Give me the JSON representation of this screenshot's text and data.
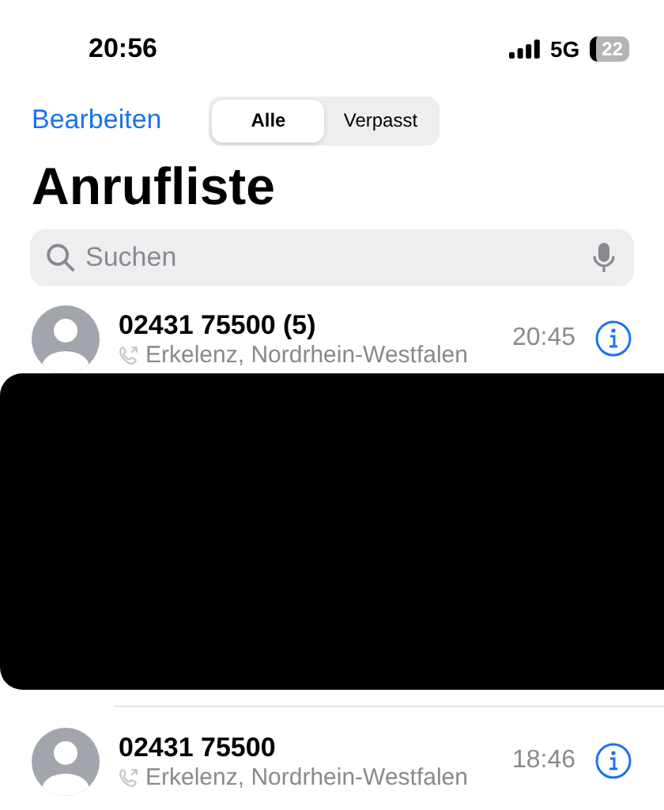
{
  "status_bar": {
    "time": "20:56",
    "network": "5G",
    "battery": "22"
  },
  "nav": {
    "edit": "Bearbeiten",
    "segments": [
      {
        "label": "Alle",
        "selected": true
      },
      {
        "label": "Verpasst",
        "selected": false
      }
    ]
  },
  "title": "Anrufliste",
  "search": {
    "placeholder": "Suchen"
  },
  "calls": [
    {
      "number": "02431 75500 (5)",
      "location": "Erkelenz, Nordrhein-Westfalen",
      "time": "20:45"
    },
    {
      "kind": "redacted"
    },
    {
      "number": "02431 75500",
      "location": "Erkelenz, Nordrhein-Westfalen",
      "time": "18:46"
    }
  ]
}
